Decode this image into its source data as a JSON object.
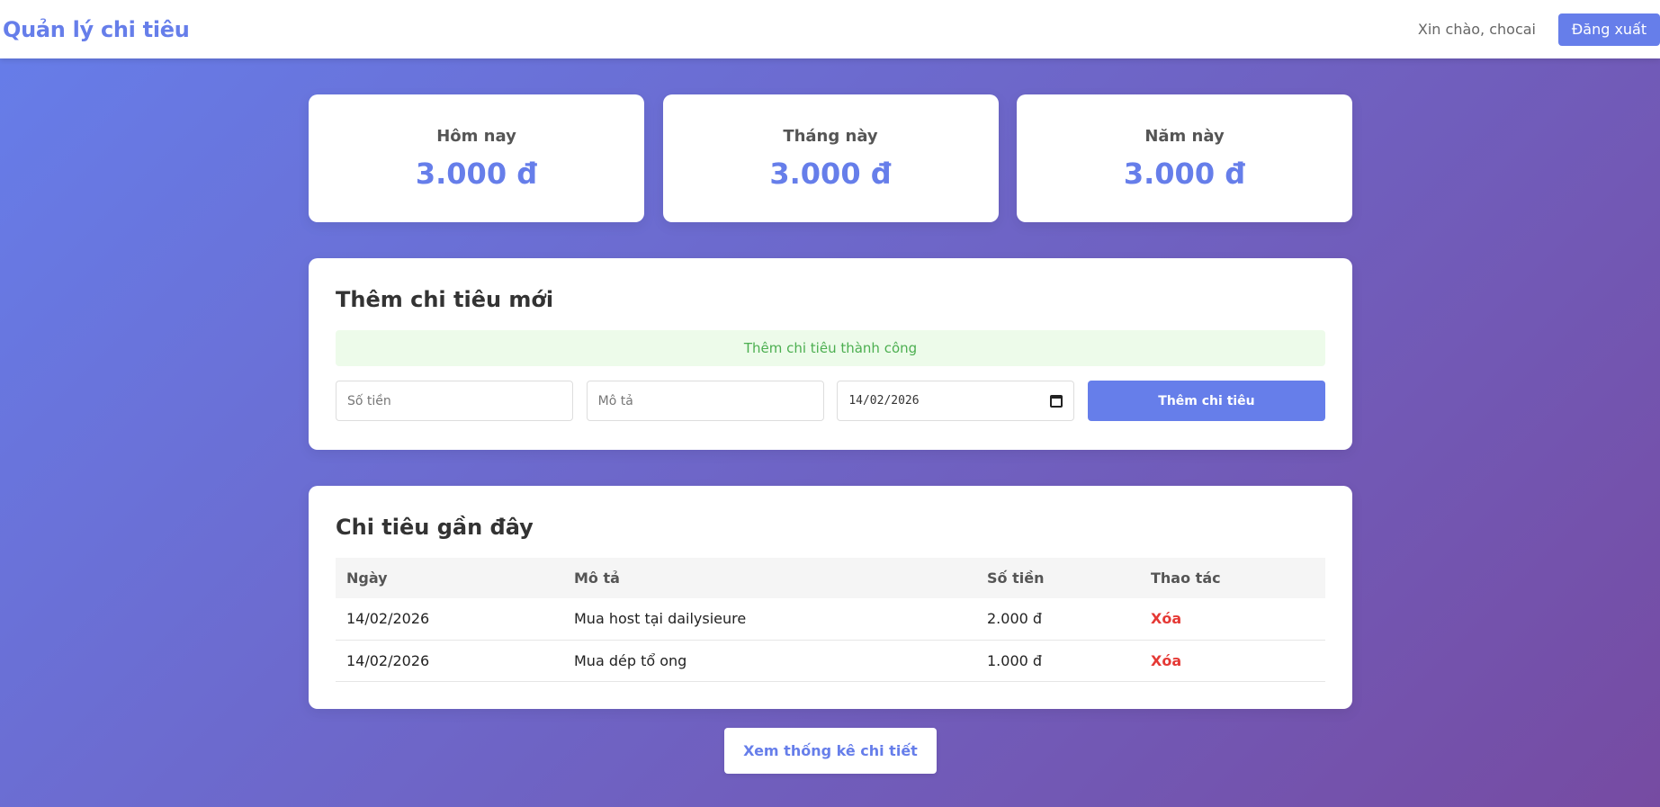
{
  "navbar": {
    "brand": "Quản lý chi tiêu",
    "greeting": "Xin chào, chocai",
    "logout_label": "Đăng xuất"
  },
  "stats": [
    {
      "label": "Hôm nay",
      "value": "3.000 đ"
    },
    {
      "label": "Tháng này",
      "value": "3.000 đ"
    },
    {
      "label": "Năm này",
      "value": "3.000 đ"
    }
  ],
  "add_form": {
    "title": "Thêm chi tiêu mới",
    "alert": "Thêm chi tiêu thành công",
    "amount_placeholder": "Số tiền",
    "description_placeholder": "Mô tả",
    "date_value": "14/02/2026",
    "submit_label": "Thêm chi tiêu"
  },
  "recent": {
    "title": "Chi tiêu gần đây",
    "columns": [
      "Ngày",
      "Mô tả",
      "Số tiền",
      "Thao tác"
    ],
    "rows": [
      {
        "date": "14/02/2026",
        "description": "Mua host tại dailysieure",
        "amount": "2.000 đ",
        "action": "Xóa"
      },
      {
        "date": "14/02/2026",
        "description": "Mua dép tổ ong",
        "amount": "1.000 đ",
        "action": "Xóa"
      }
    ]
  },
  "footer": {
    "stats_button": "Xem thống kê chi tiết"
  },
  "colors": {
    "accent": "#667eea",
    "gradient_end": "#764ba2",
    "success": "#4caf50",
    "danger": "#e53935"
  }
}
